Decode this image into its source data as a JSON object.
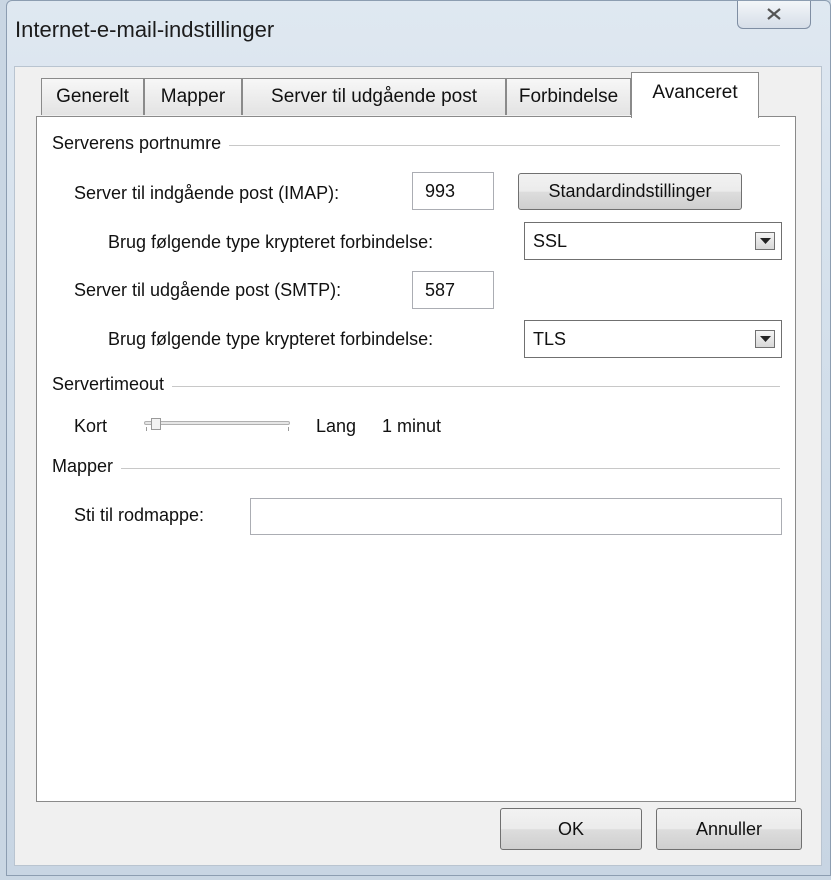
{
  "window": {
    "title": "Internet-e-mail-indstillinger"
  },
  "tabs": [
    {
      "label": "Generelt"
    },
    {
      "label": "Mapper"
    },
    {
      "label": "Server til udgående post"
    },
    {
      "label": "Forbindelse"
    },
    {
      "label": "Avanceret"
    }
  ],
  "ports": {
    "group_label": "Serverens portnumre",
    "imap_label": "Server til indgående post (IMAP):",
    "imap_value": "993",
    "defaults_button": "Standardindstillinger",
    "imap_encryption_label": "Brug følgende type krypteret forbindelse:",
    "imap_encryption_value": "SSL",
    "smtp_label": "Server til udgående post (SMTP):",
    "smtp_value": "587",
    "smtp_encryption_label": "Brug følgende type krypteret forbindelse:",
    "smtp_encryption_value": "TLS"
  },
  "timeout": {
    "group_label": "Servertimeout",
    "short_label": "Kort",
    "long_label": "Lang",
    "value_text": "1 minut",
    "slider_fraction": 0.05
  },
  "folders": {
    "group_label": "Mapper",
    "root_path_label": "Sti til rodmappe:",
    "root_path_value": ""
  },
  "footer": {
    "ok_label": "OK",
    "cancel_label": "Annuller"
  },
  "icons": {
    "close": "close-icon",
    "dropdown": "chevron-down-icon"
  }
}
